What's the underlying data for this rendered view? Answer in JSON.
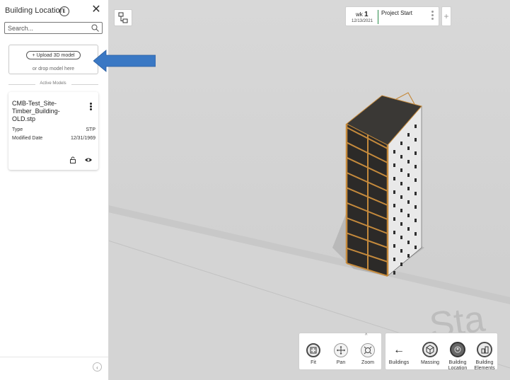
{
  "sidebar": {
    "title": "Building Location",
    "search_placeholder": "Search...",
    "upload_label": "+ Upload 3D model",
    "drop_text": "or drop model here",
    "active_models_label": "Active Models",
    "model": {
      "name": "CMB-Test_Site-Timber_Building-OLD.stp",
      "type_label": "Type",
      "type_value": "STP",
      "modified_label": "Modified Date",
      "modified_value": "12/31/1969"
    }
  },
  "timeline": {
    "week_prefix": "wk",
    "week_number": "1",
    "date": "12/13/2021",
    "title": "Project Start"
  },
  "toolbar_view": [
    {
      "label": "Fit",
      "icon": "fit-icon"
    },
    {
      "label": "Pan",
      "icon": "pan-icon"
    },
    {
      "label": "Zoom",
      "icon": "zoom-icon"
    }
  ],
  "toolbar_nav": [
    {
      "label": "Buildings",
      "icon": "back-arrow-icon"
    },
    {
      "label": "Massing",
      "icon": "cube-icon"
    },
    {
      "label": "Building Location",
      "icon": "location-icon",
      "active": true
    },
    {
      "label": "Building Elements",
      "icon": "elements-icon"
    }
  ],
  "ground_text": "Sta",
  "colors": {
    "accent_arrow": "#3a78c4",
    "timeline_marker": "#2a8a4a",
    "timber": "#c58a3c"
  }
}
